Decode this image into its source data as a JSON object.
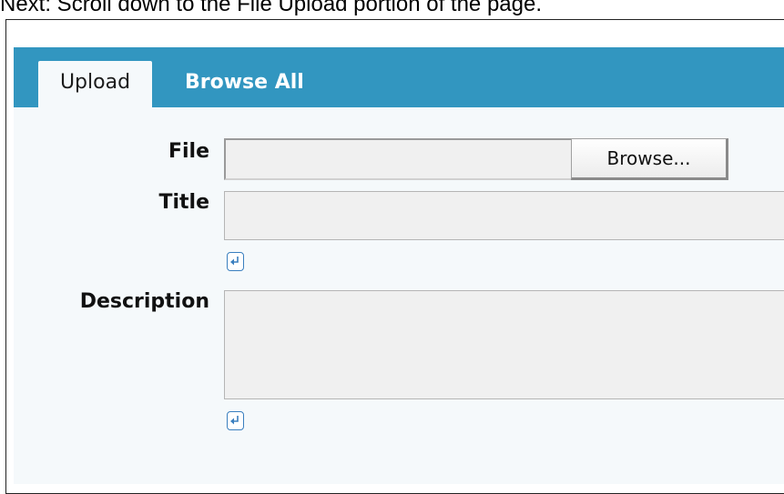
{
  "instruction": "Next: Scroll down to the File Upload portion of the page.",
  "tabs": {
    "upload": "Upload",
    "browse_all": "Browse All"
  },
  "form": {
    "file_label": "File",
    "file_value": "",
    "browse_button": "Browse...",
    "title_label": "Title",
    "title_value": "",
    "description_label": "Description",
    "description_value": ""
  },
  "colors": {
    "tab_bar": "#3296c0",
    "panel_background": "#f5f9fb",
    "field_background": "#f0f0f0"
  },
  "icons": {
    "title_toggle": "return-arrow-icon",
    "description_toggle": "return-arrow-icon"
  }
}
